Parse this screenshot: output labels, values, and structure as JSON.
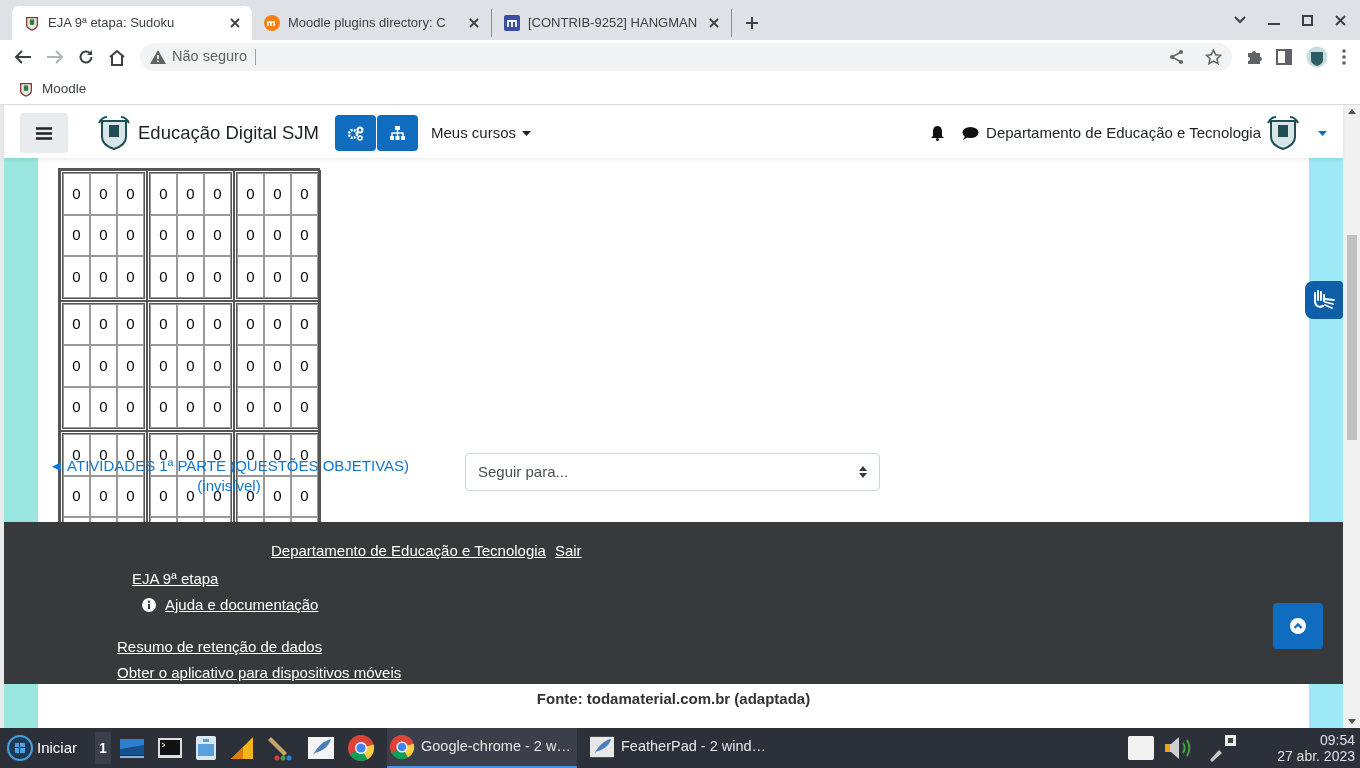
{
  "browser": {
    "tabs": [
      {
        "title": "EJA 9ª etapa: Sudoku",
        "selected": true
      },
      {
        "title": "Moodle plugins directory: C",
        "selected": false
      },
      {
        "title": "[CONTRIB-9252] HANGMAN",
        "selected": false
      }
    ],
    "security": "Não seguro",
    "bookmarks": [
      "Moodle"
    ]
  },
  "navbar": {
    "site_name": "Educação Digital SJM",
    "menu": "Meus cursos",
    "user": "Departamento de Educação e Tecnologia"
  },
  "sudoku": {
    "rows": [
      [
        "0",
        "0",
        "0",
        "0",
        "0",
        "0",
        "0",
        "0",
        "0"
      ],
      [
        "0",
        "0",
        "0",
        "0",
        "0",
        "0",
        "0",
        "0",
        "0"
      ],
      [
        "0",
        "0",
        "0",
        "0",
        "0",
        "0",
        "0",
        "0",
        "0"
      ],
      [
        "0",
        "0",
        "0",
        "0",
        "0",
        "0",
        "0",
        "0",
        "0"
      ],
      [
        "0",
        "0",
        "0",
        "0",
        "0",
        "0",
        "0",
        "0",
        "0"
      ],
      [
        "0",
        "0",
        "0",
        "0",
        "0",
        "0",
        "0",
        "0",
        "0"
      ],
      [
        "0",
        "0",
        "0",
        "0",
        "0",
        "0",
        "0",
        "0",
        "0"
      ],
      [
        "0",
        "0",
        "0",
        "0",
        "0",
        "0",
        "0",
        "0",
        "0"
      ]
    ]
  },
  "navigation": {
    "previous_link": "◄ ATIVIDADES 1ª PARTE (QUESTÕES OBJETIVAS)",
    "previous_note": "(invisível)",
    "jump_select": {
      "value": "Seguir para..."
    }
  },
  "footer": {
    "user": "Departamento de Educação e Tecnologia",
    "logout": "Sair",
    "course": "EJA 9ª etapa",
    "help": "Ajuda e documentação",
    "links": [
      "Resumo de retenção de dados",
      "Obter o aplicativo para dispositivos móveis"
    ]
  },
  "source": "Fonte: todamaterial.com.br (adaptada)",
  "taskbar": {
    "start": "Iniciar",
    "workspace": "1",
    "windows": [
      {
        "title": "Google-chrome - 2 w…",
        "selected": true,
        "kind": "chrome"
      },
      {
        "title": "FeatherPad - 2 wind…",
        "selected": false,
        "kind": "featherpad"
      }
    ],
    "time": "09:54",
    "date": "27 abr. 2023"
  }
}
